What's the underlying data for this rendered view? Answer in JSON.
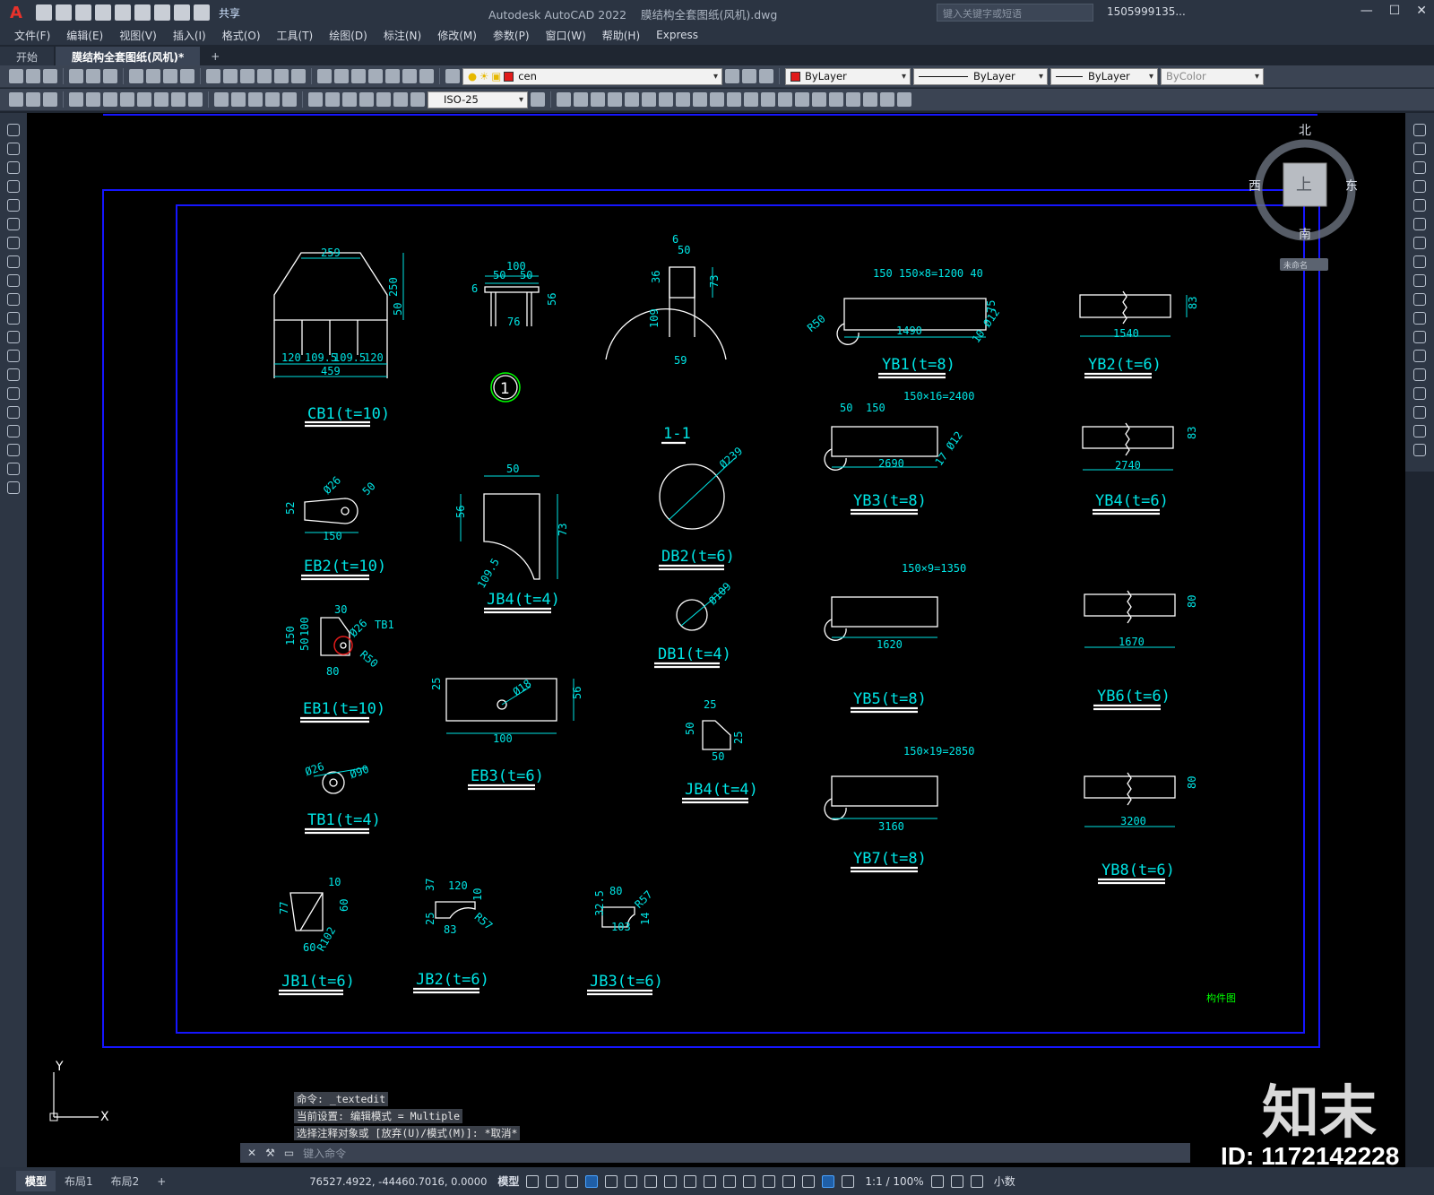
{
  "app": {
    "logo": "A",
    "title": "Autodesk AutoCAD 2022",
    "file": "膜结构全套图纸(风机).dwg",
    "share": "共享",
    "search_placeholder": "键入关键字或短语",
    "user": "1505999135..."
  },
  "menu": [
    "文件(F)",
    "编辑(E)",
    "视图(V)",
    "插入(I)",
    "格式(O)",
    "工具(T)",
    "绘图(D)",
    "标注(N)",
    "修改(M)",
    "参数(P)",
    "窗口(W)",
    "帮助(H)",
    "Express"
  ],
  "tabs": [
    {
      "label": "开始",
      "active": false
    },
    {
      "label": "膜结构全套图纸(风机)*",
      "active": true
    }
  ],
  "toolbar": {
    "layer": "cen",
    "color": "ByLayer",
    "linetype": "ByLayer",
    "lineweight": "ByLayer",
    "plotstyle": "ByColor",
    "dimstyle": "ISO-25"
  },
  "viewcube": {
    "north": "北",
    "south": "南",
    "east": "东",
    "west": "西",
    "top": "上",
    "wcs": "未命名"
  },
  "drawing": {
    "labels": {
      "cb1": "CB1(t=10)",
      "eb2": "EB2(t=10)",
      "eb1": "EB1(t=10)",
      "tb1": "TB1(t=4)",
      "jb4a": "JB4(t=4)",
      "eb3": "EB3(t=6)",
      "db2": "DB2(t=6)",
      "db1": "DB1(t=4)",
      "jb4b": "JB4(t=4)",
      "jb1": "JB1(t=6)",
      "jb2": "JB2(t=6)",
      "jb3": "JB3(t=6)",
      "yb1": "YB1(t=8)",
      "yb2": "YB2(t=6)",
      "yb3": "YB3(t=8)",
      "yb4": "YB4(t=6)",
      "yb5": "YB5(t=8)",
      "yb6": "YB6(t=6)",
      "yb7": "YB7(t=8)",
      "yb8": "YB8(t=6)",
      "section": "1-1",
      "bubble": "1",
      "footer": "构件图"
    },
    "dims": {
      "cb1_top": "259",
      "cb1_h1": "250",
      "cb1_h2": "50",
      "cb1_b1": "120",
      "cb1_b2": "109.5",
      "cb1_b3": "109.5",
      "cb1_b4": "120",
      "cb1_total": "459",
      "d_100": "100",
      "d_50a": "50",
      "d_50b": "50",
      "d_76": "76",
      "d_56": "56",
      "d_6": "6",
      "arc_6": "6",
      "arc_50": "50",
      "arc_36": "36",
      "arc_73": "73",
      "arc_109": "109",
      "arc_59": "59",
      "yb1_top": "150 150×8=1200 40",
      "yb1_len": "1490",
      "yb1_r": "R50",
      "yb1_hole": "10 Ø12",
      "yb1_w": "75",
      "yb2_len": "1540",
      "yb2_h": "83",
      "yb3_top": "150×16=2400",
      "yb3_150": "150",
      "yb3_50": "50",
      "yb3_len": "2690",
      "yb3_hole": "17 Ø12",
      "yb4_len": "2740",
      "yb4_h": "83",
      "yb5_top": "150×9=1350",
      "yb5_len": "1620",
      "yb6_len": "1670",
      "yb6_h": "80",
      "yb7_top": "150×19=2850",
      "yb7_len": "3160",
      "yb8_len": "3200",
      "yb8_h": "80",
      "eb2_d": "Ø26",
      "eb2_50": "50",
      "eb2_52": "52",
      "eb2_150": "150",
      "jb4_50": "50",
      "jb4_56": "56",
      "jb4_73": "73",
      "jb4_r": "109.5",
      "db2_d": "Ø239",
      "db1_d": "Ø109",
      "eb1_30": "30",
      "eb1_d": "Ø26",
      "eb1_tb1": "TB1",
      "eb1_150": "150",
      "eb1_100": "100",
      "eb1_50": "50",
      "eb1_80": "80",
      "eb1_r": "R50",
      "eb3_25": "25",
      "eb3_d": "Ø18",
      "eb3_56": "56",
      "eb3_100": "100",
      "jb4b_25": "25",
      "jb4b_50a": "50",
      "jb4b_50b": "50",
      "jb4b_25b": "25",
      "tb1_d1": "Ø26",
      "tb1_d2": "Ø90",
      "jb1_10": "10",
      "jb1_77": "77",
      "jb1_60a": "60",
      "jb1_60b": "60",
      "jb1_r": "R102",
      "jb2_120": "120",
      "jb2_37": "37",
      "jb2_25": "25",
      "jb2_83": "83",
      "jb2_r": "R57",
      "jb2_10": "10",
      "jb3_80": "80",
      "jb3_r": "R57",
      "jb3_32": "32.5",
      "jb3_103": "103",
      "jb3_14": "14"
    }
  },
  "command": {
    "history": [
      "命令: _textedit",
      "当前设置: 编辑模式 = Multiple",
      "选择注释对象或 [放弃(U)/模式(M)]: *取消*"
    ],
    "prompt": "键入命令"
  },
  "status": {
    "layouts": [
      "模型",
      "布局1",
      "布局2"
    ],
    "coords": "76527.4922, -44460.7016, 0.0000",
    "space": "模型",
    "scale": "1:1 / 100%",
    "units": "小数"
  },
  "watermark": {
    "brand": "知末",
    "id": "ID: 1172142228"
  },
  "colors": {
    "canvas": "#000000",
    "cad_white": "#ffffff",
    "cad_cyan": "#00e5e5",
    "cad_blue": "#0000ff",
    "cad_green": "#00ff00"
  }
}
